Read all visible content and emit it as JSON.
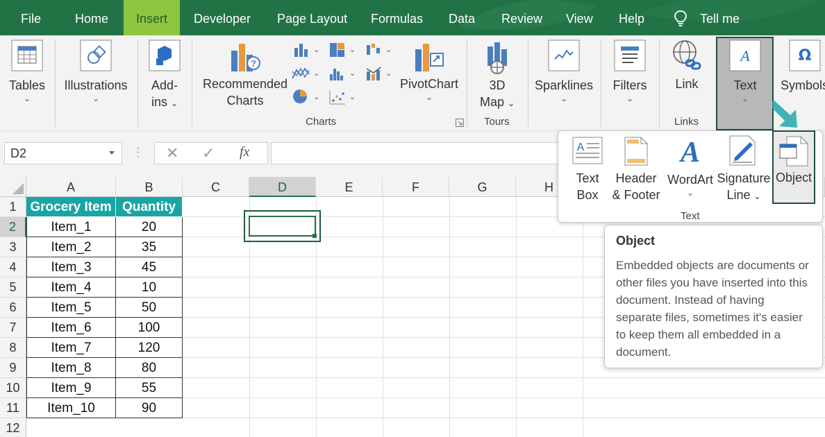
{
  "menu": {
    "tabs": [
      "File",
      "Home",
      "Insert",
      "Developer",
      "Page Layout",
      "Formulas",
      "Data",
      "Review",
      "View",
      "Help"
    ],
    "active_tab": "Insert",
    "tell_me": "Tell me"
  },
  "ribbon": {
    "tables": "Tables",
    "illustrations": "Illustrations",
    "addins_line1": "Add-",
    "addins_line2": "ins",
    "recommended_line1": "Recommended",
    "recommended_line2": "Charts",
    "pivotchart": "PivotChart",
    "map_line1": "3D",
    "map_line2": "Map",
    "sparklines": "Sparklines",
    "filters": "Filters",
    "link": "Link",
    "text": "Text",
    "symbols": "Symbols",
    "groups": {
      "charts": "Charts",
      "tours": "Tours",
      "links": "Links"
    },
    "chevron": "⌄"
  },
  "formula_bar": {
    "name_box": "D2",
    "cancel": "✕",
    "enter": "✓",
    "fx": "fx",
    "formula": ""
  },
  "grid": {
    "columns": [
      "A",
      "B",
      "C",
      "D",
      "E",
      "F",
      "G",
      "H"
    ],
    "rows": [
      "1",
      "2",
      "3",
      "4",
      "5",
      "6",
      "7",
      "8",
      "9",
      "10",
      "11",
      "12"
    ],
    "selected_cell": "D2"
  },
  "table": {
    "headers": [
      "Grocery Item",
      "Quantity"
    ],
    "rows": [
      [
        "Item_1",
        "20"
      ],
      [
        "Item_2",
        "35"
      ],
      [
        "Item_3",
        "45"
      ],
      [
        "Item_4",
        "10"
      ],
      [
        "Item_5",
        "50"
      ],
      [
        "Item_6",
        "100"
      ],
      [
        "Item_7",
        "120"
      ],
      [
        "Item_8",
        "80"
      ],
      [
        "Item_9",
        "55"
      ],
      [
        "Item_10",
        "90"
      ]
    ]
  },
  "text_dropdown": {
    "textbox_line1": "Text",
    "textbox_line2": "Box",
    "header_line1": "Header",
    "header_line2": "& Footer",
    "wordart": "WordArt",
    "signature_line1": "Signature",
    "signature_line2": "Line",
    "object": "Object",
    "group_label": "Text"
  },
  "tooltip": {
    "title": "Object",
    "body": "Embedded objects are documents or other files you have inserted into this document. Instead of having separate files, sometimes it's easier to keep them all embedded in a document."
  },
  "colors": {
    "excel_green": "#217346",
    "active_tab": "#8fc63f",
    "table_header": "#1aa5a5",
    "arrow": "#20a8a8"
  }
}
